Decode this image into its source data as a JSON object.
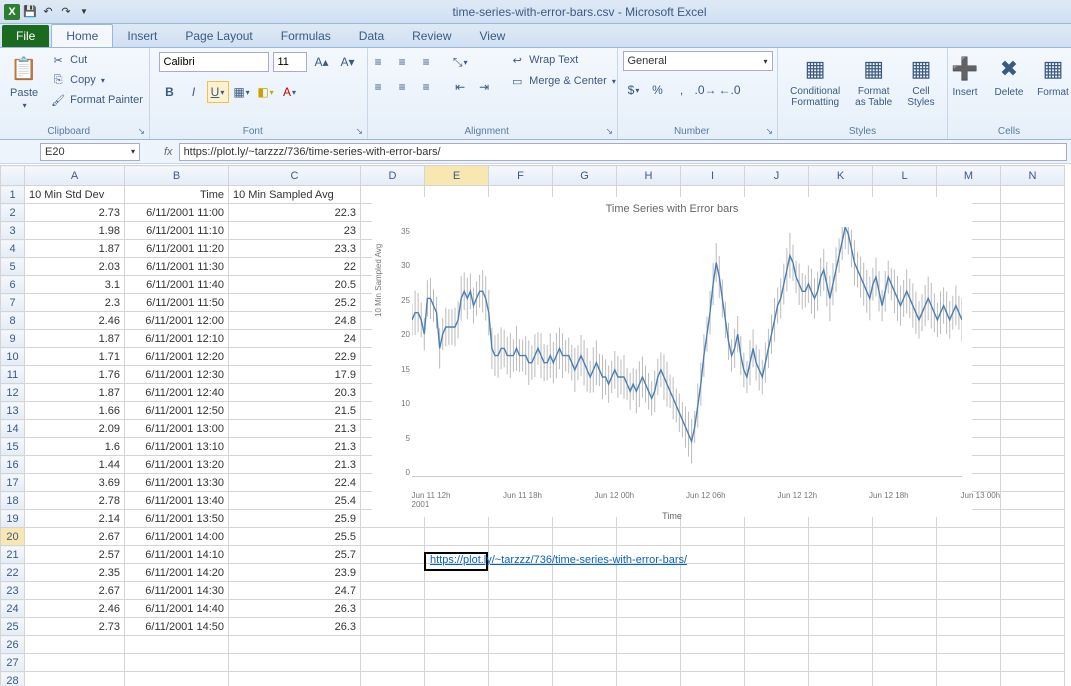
{
  "app": {
    "title": "time-series-with-error-bars.csv - Microsoft Excel"
  },
  "qat": {
    "save": "💾",
    "undo": "↶",
    "redo": "↷"
  },
  "tabs": {
    "file": "File",
    "home": "Home",
    "insert": "Insert",
    "pagelayout": "Page Layout",
    "formulas": "Formulas",
    "data": "Data",
    "review": "Review",
    "view": "View"
  },
  "clipboard": {
    "paste": "Paste",
    "cut": "Cut",
    "copy": "Copy",
    "formatpainter": "Format Painter",
    "group": "Clipboard"
  },
  "font": {
    "family": "Calibri",
    "size": "11",
    "group": "Font"
  },
  "alignment": {
    "wrap": "Wrap Text",
    "merge": "Merge & Center",
    "group": "Alignment"
  },
  "number": {
    "format": "General",
    "group": "Number"
  },
  "styles": {
    "cond": "Conditional Formatting",
    "table": "Format as Table",
    "cell": "Cell Styles",
    "group": "Styles"
  },
  "cells": {
    "insert": "Insert",
    "delete": "Delete",
    "format": "Format",
    "group": "Cells"
  },
  "namebox": "E20",
  "formula": "https://plot.ly/~tarzzz/736/time-series-with-error-bars/",
  "columns": [
    "A",
    "B",
    "C",
    "D",
    "E",
    "F",
    "G",
    "H",
    "I",
    "J",
    "K",
    "L",
    "M",
    "N"
  ],
  "headers": {
    "A": "10 Min Std Dev",
    "B": "Time",
    "C": "10 Min Sampled Avg"
  },
  "link_cell": "https://plot.ly/~tarzzz/736/time-series-with-error-bars/",
  "rows": [
    {
      "n": 1,
      "a": "10 Min Std Dev",
      "b": "Time",
      "c": "10 Min Sampled Avg",
      "hdr": true
    },
    {
      "n": 2,
      "a": "2.73",
      "b": "6/11/2001 11:00",
      "c": "22.3"
    },
    {
      "n": 3,
      "a": "1.98",
      "b": "6/11/2001 11:10",
      "c": "23"
    },
    {
      "n": 4,
      "a": "1.87",
      "b": "6/11/2001 11:20",
      "c": "23.3"
    },
    {
      "n": 5,
      "a": "2.03",
      "b": "6/11/2001 11:30",
      "c": "22"
    },
    {
      "n": 6,
      "a": "3.1",
      "b": "6/11/2001 11:40",
      "c": "20.5"
    },
    {
      "n": 7,
      "a": "2.3",
      "b": "6/11/2001 11:50",
      "c": "25.2"
    },
    {
      "n": 8,
      "a": "2.46",
      "b": "6/11/2001 12:00",
      "c": "24.8"
    },
    {
      "n": 9,
      "a": "1.87",
      "b": "6/11/2001 12:10",
      "c": "24"
    },
    {
      "n": 10,
      "a": "1.71",
      "b": "6/11/2001 12:20",
      "c": "22.9"
    },
    {
      "n": 11,
      "a": "1.76",
      "b": "6/11/2001 12:30",
      "c": "17.9"
    },
    {
      "n": 12,
      "a": "1.87",
      "b": "6/11/2001 12:40",
      "c": "20.3"
    },
    {
      "n": 13,
      "a": "1.66",
      "b": "6/11/2001 12:50",
      "c": "21.5"
    },
    {
      "n": 14,
      "a": "2.09",
      "b": "6/11/2001 13:00",
      "c": "21.3"
    },
    {
      "n": 15,
      "a": "1.6",
      "b": "6/11/2001 13:10",
      "c": "21.3"
    },
    {
      "n": 16,
      "a": "1.44",
      "b": "6/11/2001 13:20",
      "c": "21.3"
    },
    {
      "n": 17,
      "a": "3.69",
      "b": "6/11/2001 13:30",
      "c": "22.4"
    },
    {
      "n": 18,
      "a": "2.78",
      "b": "6/11/2001 13:40",
      "c": "25.4"
    },
    {
      "n": 19,
      "a": "2.14",
      "b": "6/11/2001 13:50",
      "c": "25.9"
    },
    {
      "n": 20,
      "a": "2.67",
      "b": "6/11/2001 14:00",
      "c": "25.5"
    },
    {
      "n": 21,
      "a": "2.57",
      "b": "6/11/2001 14:10",
      "c": "25.7"
    },
    {
      "n": 22,
      "a": "2.35",
      "b": "6/11/2001 14:20",
      "c": "23.9"
    },
    {
      "n": 23,
      "a": "2.67",
      "b": "6/11/2001 14:30",
      "c": "24.7"
    },
    {
      "n": 24,
      "a": "2.46",
      "b": "6/11/2001 14:40",
      "c": "26.3"
    },
    {
      "n": 25,
      "a": "2.73",
      "b": "6/11/2001 14:50",
      "c": "26.3"
    }
  ],
  "chart_data": {
    "type": "line",
    "title": "Time Series with Error bars",
    "xlabel": "Time",
    "ylabel": "10 Min Sampled Avg",
    "ylim": [
      0,
      35
    ],
    "yticks": [
      0,
      5,
      10,
      15,
      20,
      25,
      30,
      35
    ],
    "xticks": [
      "Jun 11 12h\n2001",
      "Jun 11 18h",
      "Jun 12 00h",
      "Jun 12 06h",
      "Jun 12 12h",
      "Jun 12 18h",
      "Jun 13 00h"
    ],
    "series": [
      {
        "name": "10 Min Sampled Avg",
        "values": [
          22,
          23,
          23,
          22,
          20,
          25,
          25,
          24,
          23,
          18,
          20,
          21,
          21,
          21,
          21,
          22,
          25,
          26,
          25,
          26,
          24,
          25,
          26,
          26,
          25,
          23,
          18,
          17,
          17,
          18,
          18,
          17,
          17,
          17,
          18,
          17,
          17,
          17,
          16,
          16,
          17,
          18,
          17,
          16,
          16,
          17,
          16,
          17,
          18,
          17,
          17,
          17,
          16,
          15,
          16,
          17,
          16,
          15,
          14,
          15,
          16,
          15,
          14,
          14,
          13,
          14,
          15,
          14,
          14,
          14,
          13,
          12,
          13,
          12,
          13,
          14,
          13,
          12,
          11,
          12,
          14,
          15,
          14,
          13,
          12,
          11,
          10,
          9,
          8,
          7,
          6,
          5,
          7,
          10,
          13,
          17,
          20,
          23,
          27,
          30,
          28,
          25,
          22,
          19,
          17,
          18,
          20,
          17,
          15,
          14,
          16,
          18,
          16,
          15,
          14,
          16,
          18,
          20,
          22,
          24,
          25,
          27,
          29,
          31,
          30,
          28,
          27,
          26,
          26,
          27,
          26,
          25,
          26,
          28,
          29,
          27,
          25,
          27,
          29,
          31,
          33,
          35,
          34,
          32,
          30,
          29,
          28,
          27,
          26,
          25,
          27,
          28,
          26,
          24,
          26,
          28,
          27,
          26,
          25,
          24,
          25,
          26,
          25,
          24,
          23,
          22,
          23,
          24,
          25,
          24,
          23,
          22,
          23,
          24,
          23,
          22,
          23,
          24,
          23,
          22
        ]
      }
    ]
  }
}
